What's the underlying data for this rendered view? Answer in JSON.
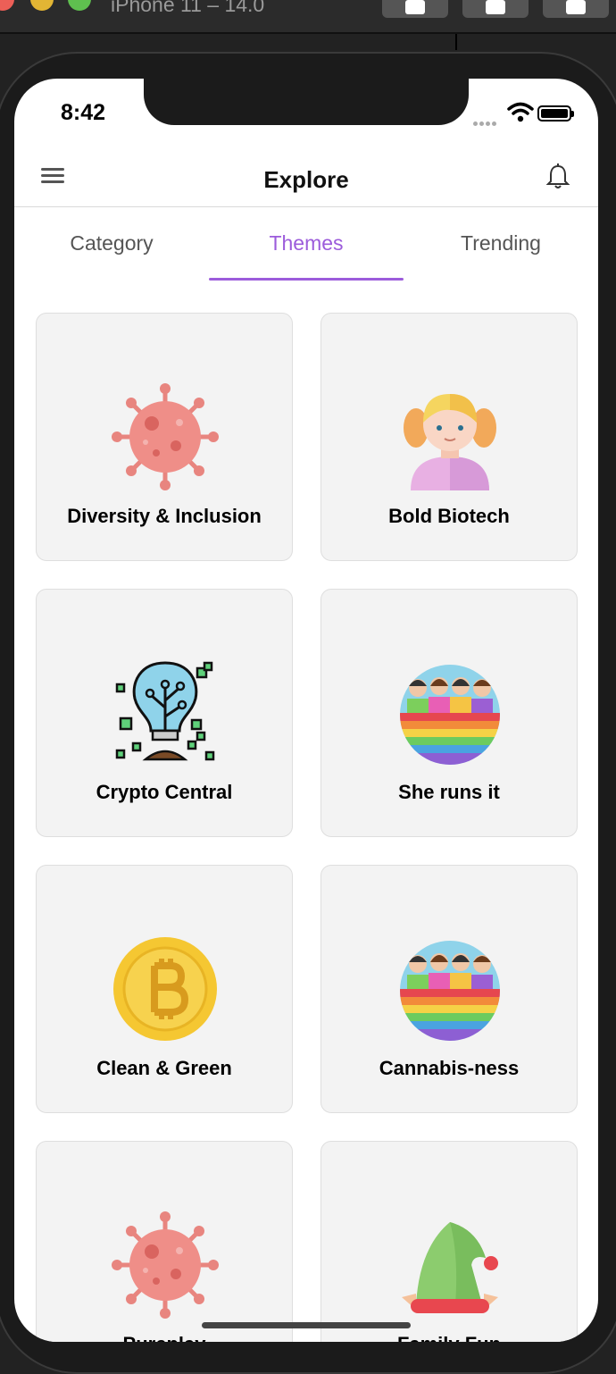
{
  "simulator": {
    "title": "iPhone 11 – 14.0"
  },
  "status_bar": {
    "time": "8:42"
  },
  "header": {
    "title": "Explore",
    "menu_icon": "hamburger-menu-icon",
    "bell_icon": "bell-icon"
  },
  "tabs": [
    {
      "label": "Category",
      "active": false
    },
    {
      "label": "Themes",
      "active": true
    },
    {
      "label": "Trending",
      "active": false
    }
  ],
  "colors": {
    "accent": "#9c5cdb",
    "card_bg": "#f3f3f3"
  },
  "cards": [
    {
      "label": "Diversity & Inclusion",
      "icon": "virus-icon"
    },
    {
      "label": "Bold Biotech",
      "icon": "girl-avatar-icon"
    },
    {
      "label": "Crypto Central",
      "icon": "bulb-plant-icon"
    },
    {
      "label": "She runs it",
      "icon": "rainbow-crowd-icon"
    },
    {
      "label": "Clean & Green",
      "icon": "bitcoin-coin-icon"
    },
    {
      "label": "Cannabis-ness",
      "icon": "rainbow-crowd-icon"
    },
    {
      "label": "Pureplay",
      "icon": "virus-icon"
    },
    {
      "label": "Family Fun",
      "icon": "elf-hat-icon"
    }
  ]
}
